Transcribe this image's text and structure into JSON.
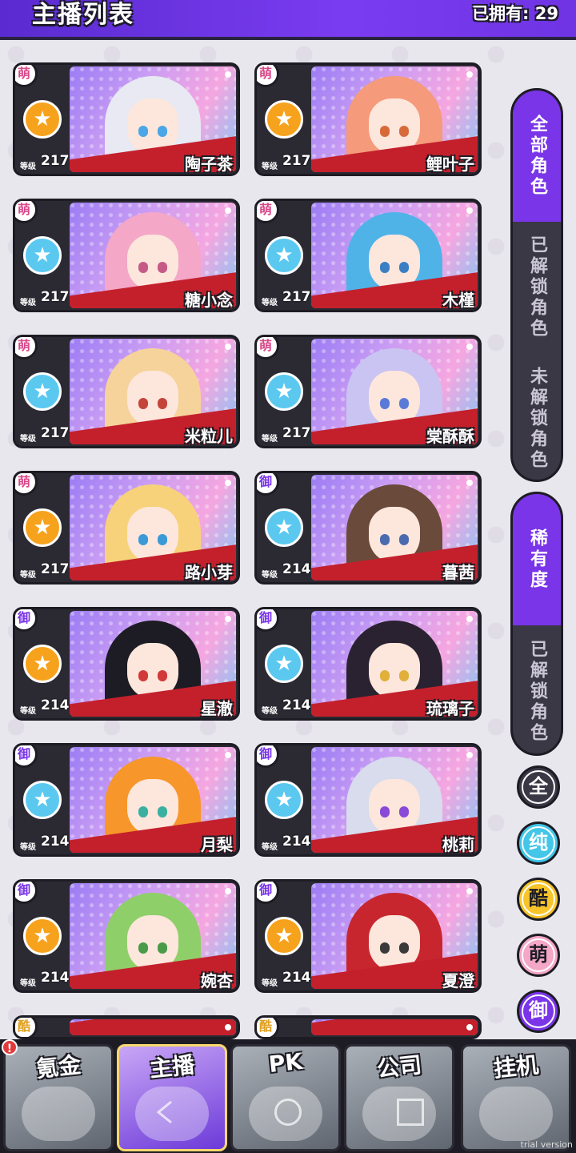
{
  "header": {
    "title": "主播列表",
    "owned_count": "已拥有: 29"
  },
  "cards": [
    {
      "rank": "萌",
      "level_label": "等级",
      "level": "217",
      "name": "陶子茶",
      "type_color": "#f7a21c",
      "hair": "#e8e9f2",
      "eye": "#4aa6e6"
    },
    {
      "rank": "萌",
      "level_label": "等级",
      "level": "217",
      "name": "鲤叶子",
      "type_color": "#f7a21c",
      "hair": "#f59a7a",
      "eye": "#d86a3a"
    },
    {
      "rank": "萌",
      "level_label": "等级",
      "level": "217",
      "name": "糖小念",
      "type_color": "#5bc8f0",
      "hair": "#f4a7c7",
      "eye": "#c65a86"
    },
    {
      "rank": "萌",
      "level_label": "等级",
      "level": "217",
      "name": "木槿",
      "type_color": "#5bc8f0",
      "hair": "#4fb3e8",
      "eye": "#3a7fc4"
    },
    {
      "rank": "萌",
      "level_label": "等级",
      "level": "217",
      "name": "米粒儿",
      "type_color": "#5bc8f0",
      "hair": "#f6d39a",
      "eye": "#c4443a"
    },
    {
      "rank": "萌",
      "level_label": "等级",
      "level": "217",
      "name": "棠酥酥",
      "type_color": "#5bc8f0",
      "hair": "#c9c4f2",
      "eye": "#5a7ad8"
    },
    {
      "rank": "萌",
      "level_label": "等级",
      "level": "217",
      "name": "路小芽",
      "type_color": "#f7a21c",
      "hair": "#f7d27a",
      "eye": "#3a9ad8"
    },
    {
      "rank": "御",
      "level_label": "等级",
      "level": "214",
      "name": "暮茜",
      "type_color": "#5bc8f0",
      "hair": "#6a4a3a",
      "eye": "#4a6ab0"
    },
    {
      "rank": "御",
      "level_label": "等级",
      "level": "214",
      "name": "星澈",
      "type_color": "#f7a21c",
      "hair": "#1d1c24",
      "eye": "#d23a3a"
    },
    {
      "rank": "御",
      "level_label": "等级",
      "level": "214",
      "name": "琉璃子",
      "type_color": "#5bc8f0",
      "hair": "#2a2230",
      "eye": "#e0b03a"
    },
    {
      "rank": "御",
      "level_label": "等级",
      "level": "214",
      "name": "月梨",
      "type_color": "#5bc8f0",
      "hair": "#f7962a",
      "eye": "#3ab0a0"
    },
    {
      "rank": "御",
      "level_label": "等级",
      "level": "214",
      "name": "桃莉",
      "type_color": "#5bc8f0",
      "hair": "#d8dcec",
      "eye": "#8a4ad8"
    },
    {
      "rank": "御",
      "level_label": "等级",
      "level": "214",
      "name": "婉杏",
      "type_color": "#f7a21c",
      "hair": "#8fcf6a",
      "eye": "#4a9a4a"
    },
    {
      "rank": "御",
      "level_label": "等级",
      "level": "214",
      "name": "夏澄",
      "type_color": "#f7a21c",
      "hair": "#c8262e",
      "eye": "#3a3a3a"
    },
    {
      "rank": "酷",
      "level_label": "",
      "level": "",
      "name": "",
      "type_color": "#f7a21c",
      "hair": "#1d1c24",
      "eye": "#1d1c24"
    },
    {
      "rank": "酷",
      "level_label": "",
      "level": "",
      "name": "",
      "type_color": "#f7a21c",
      "hair": "#2a2230",
      "eye": "#1d1c24"
    }
  ],
  "filters": {
    "all_roles": "全部角色",
    "unlocked_roles": "已解锁角色",
    "locked_roles": "未解锁角色",
    "rarity": "稀有度",
    "rarity_unlocked": "已解锁角色"
  },
  "type_filters": [
    {
      "label": "全",
      "color": "#3a3845",
      "text": "#ffffff"
    },
    {
      "label": "纯",
      "color": "#43c6e8",
      "text": "#ffffff"
    },
    {
      "label": "酷",
      "color": "#f7c52a",
      "text": "#1d1c24"
    },
    {
      "label": "萌",
      "color": "#f4a7c7",
      "text": "#1d1c24"
    },
    {
      "label": "御",
      "color": "#7a35e8",
      "text": "#ffffff"
    }
  ],
  "nav": [
    {
      "label": "氪金",
      "alert": "!"
    },
    {
      "label": "主播",
      "alert": ""
    },
    {
      "label": "PK",
      "alert": ""
    },
    {
      "label": "公司",
      "alert": ""
    },
    {
      "label": "挂机",
      "alert": ""
    }
  ],
  "watermark": "trial version",
  "colors": {
    "accent": "#7a35e8",
    "rank_cute": "#d84a8a",
    "rank_mature": "#7a35e8",
    "rank_cool": "#e0a020"
  }
}
